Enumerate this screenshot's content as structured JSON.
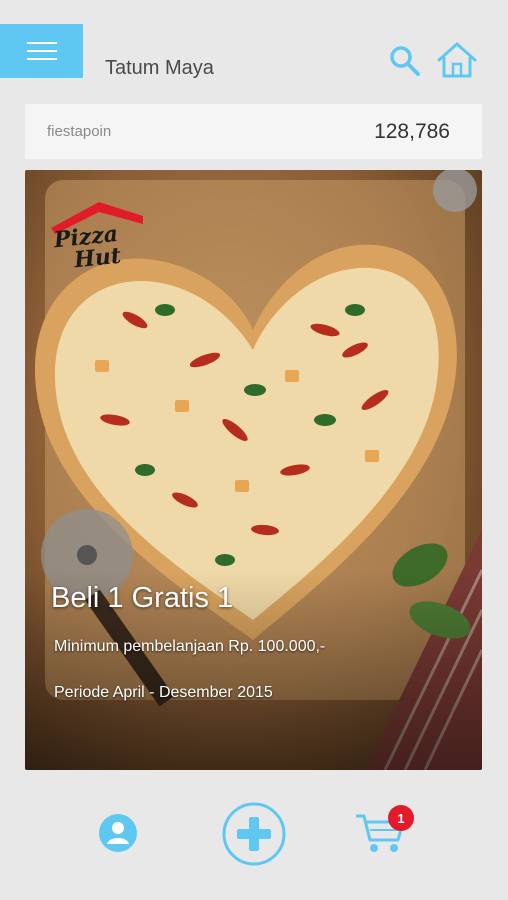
{
  "header": {
    "username": "Tatum Maya",
    "menu_icon": "hamburger-menu-icon",
    "search_icon": "search-icon",
    "home_icon": "home-icon"
  },
  "points": {
    "label": "fiestapoin",
    "value": "128,786"
  },
  "promo": {
    "brand": "Pizza Hut",
    "brand_line1": "Pizza",
    "brand_line2": "Hut",
    "title": "Beli 1 Gratis 1",
    "minimum": "Minimum pembelanjaan Rp. 100.000,-",
    "period": "Periode  April - Desember 2015"
  },
  "bottom_nav": {
    "profile_icon": "profile-icon",
    "add_icon": "add-plus-icon",
    "cart_icon": "cart-icon",
    "cart_badge": "1"
  },
  "colors": {
    "accent": "#5ec8f2",
    "badge": "#e21b2b",
    "background": "#e8e8e8"
  }
}
